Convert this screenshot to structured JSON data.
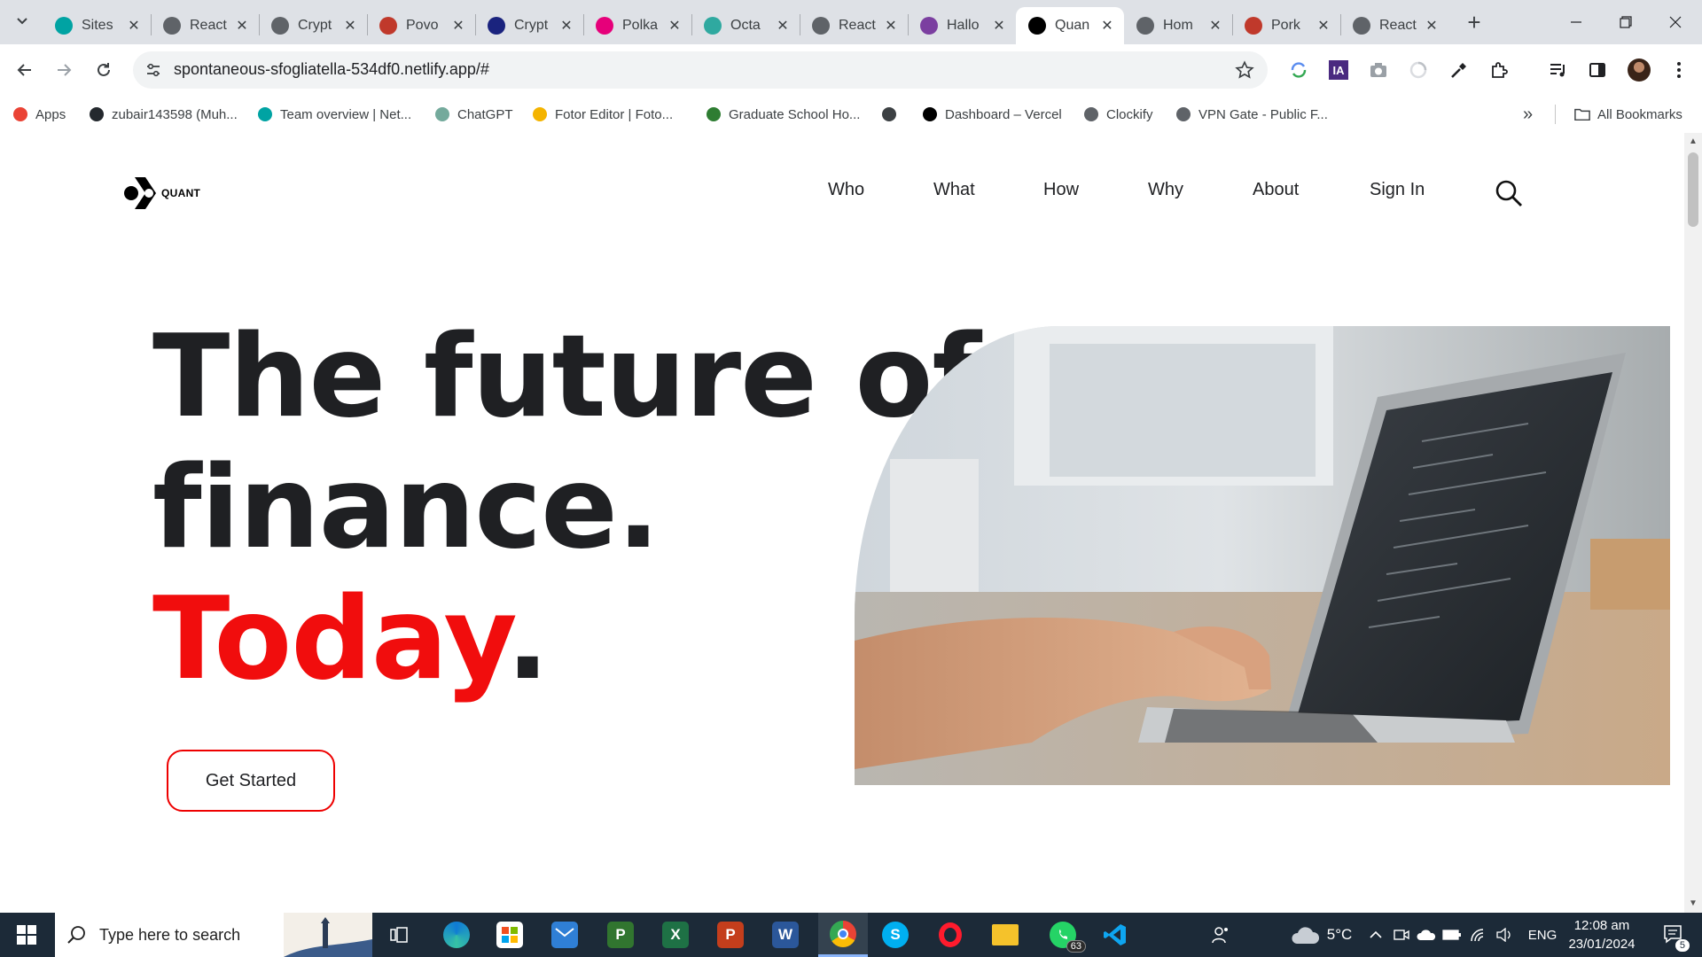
{
  "browser": {
    "tabs": [
      {
        "title": "Sites",
        "favicon": "netlify-diamond-icon",
        "color": "#00a3a3",
        "active": false
      },
      {
        "title": "React",
        "favicon": "globe-icon",
        "color": "#5f6368",
        "active": false
      },
      {
        "title": "Crypt",
        "favicon": "globe-icon",
        "color": "#5f6368",
        "active": false
      },
      {
        "title": "Povo",
        "favicon": "povo-robot-icon",
        "color": "#c0392b",
        "active": false
      },
      {
        "title": "Crypt",
        "favicon": "shield-hex-icon",
        "color": "#1a237e",
        "active": false
      },
      {
        "title": "Polka",
        "favicon": "polkadot-icon",
        "color": "#e6007a",
        "active": false
      },
      {
        "title": "Octa",
        "favicon": "octa-cloud-icon",
        "color": "#2fa9a0",
        "active": false
      },
      {
        "title": "React",
        "favicon": "globe-icon",
        "color": "#5f6368",
        "active": false
      },
      {
        "title": "Hallo",
        "favicon": "hallo-icon",
        "color": "#7b3fa0",
        "active": false
      },
      {
        "title": "Quan",
        "favicon": "quant-logo-icon",
        "color": "#000000",
        "active": true
      },
      {
        "title": "Hom",
        "favicon": "globe-icon",
        "color": "#5f6368",
        "active": false
      },
      {
        "title": "Pork",
        "favicon": "pork-icon",
        "color": "#c0392b",
        "active": false
      },
      {
        "title": "React",
        "favicon": "globe-icon",
        "color": "#5f6368",
        "active": false
      }
    ],
    "new_tab_symbol": "+",
    "url": "spontaneous-sfogliatella-534df0.netlify.app/#",
    "bookmarks": [
      {
        "label": "Apps",
        "icon": "apps-grid-icon"
      },
      {
        "label": "zubair143598 (Muh...",
        "icon": "github-icon"
      },
      {
        "label": "Team overview | Net...",
        "icon": "netlify-diamond-icon"
      },
      {
        "label": "ChatGPT",
        "icon": "openai-icon"
      },
      {
        "label": "Fotor Editor | Foto...",
        "icon": "fotor-icon"
      },
      {
        "label": "Graduate School Ho...",
        "icon": "school-icon"
      },
      {
        "label": "",
        "icon": "globe-dark-icon"
      },
      {
        "label": "Dashboard – Vercel",
        "icon": "vercel-icon"
      },
      {
        "label": "Clockify",
        "icon": "clockify-icon"
      },
      {
        "label": "VPN Gate - Public F...",
        "icon": "globe-icon"
      }
    ],
    "more_bookmarks": "»",
    "all_bookmarks": "All Bookmarks"
  },
  "site": {
    "logo_text": "QUANT",
    "nav": [
      "Who",
      "What",
      "How",
      "Why",
      "About",
      "Sign In"
    ],
    "hero": {
      "line1": "The future of",
      "line2": "finance.",
      "line3_red": "Today",
      "line3_dot": "."
    },
    "cta_label": "Get Started",
    "accent_color": "#f10d0d"
  },
  "taskbar": {
    "search_placeholder": "Type here to search",
    "whatsapp_badge": "63",
    "weather": "5°C",
    "language": "ENG",
    "time": "12:08 am",
    "date": "23/01/2024",
    "notifications": "5"
  }
}
